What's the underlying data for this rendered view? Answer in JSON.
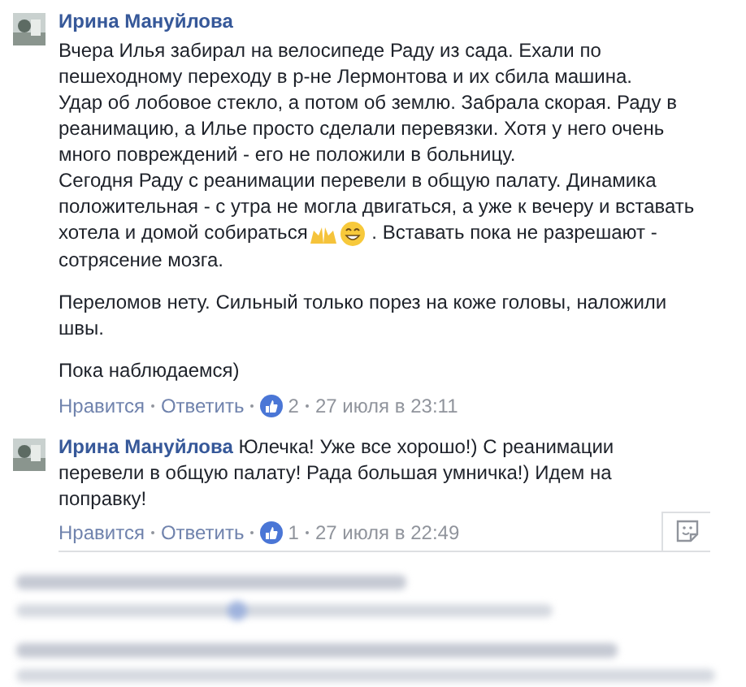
{
  "comments": [
    {
      "kind": "stacked",
      "author": "Ирина Мануйлова",
      "paragraphs": [
        [
          [
            {
              "kind": "text",
              "text": "Вчера Илья забирал на велосипеде Раду из сада. Ехали по пешеходному переходу в р-не Лермонтова и их сбила машина."
            }
          ],
          [
            {
              "kind": "text",
              "text": "Удар об лобовое стекло, а потом об землю. Забрала скорая. Раду в реанимацию, а Илье просто сделали перевязки. Хотя у него очень много повреждений - его не положили в больницу."
            }
          ],
          [
            {
              "kind": "text",
              "text": "Сегодня Раду с реанимации перевели в общую палату. Динамика положительная - с утра не могла двигаться, а уже к вечеру и вставать"
            }
          ],
          [
            {
              "kind": "text",
              "text": "хотела и домой собираться"
            },
            {
              "kind": "hands"
            },
            {
              "kind": "smile"
            },
            {
              "kind": "text",
              "text": " . Вставать пока не разрешают -"
            }
          ],
          [
            {
              "kind": "text",
              "text": "сотрясение мозга."
            }
          ]
        ],
        [
          [
            {
              "kind": "text",
              "text": "Переломов нету. Сильный только порез на коже головы, наложили швы."
            }
          ]
        ],
        [
          [
            {
              "kind": "text",
              "text": "Пока наблюдаемся)"
            }
          ]
        ]
      ],
      "like": "Нравится",
      "reply": "Ответить",
      "reactions": "2",
      "time": "27 июля в 23:11",
      "sticker_box": false
    },
    {
      "kind": "inline",
      "author": "Ирина Мануйлова",
      "paragraphs": [
        [
          [
            {
              "kind": "text",
              "text": "Юлечка! Уже все хорошо!) С реанимации"
            }
          ],
          [
            {
              "kind": "text",
              "text": "перевели в общую палату! Рада большая умничка!) Идем на поправку!"
            }
          ]
        ]
      ],
      "like": "Нравится",
      "reply": "Ответить",
      "reactions": "1",
      "time": "27 июля в 22:49",
      "sticker_box": true
    }
  ]
}
